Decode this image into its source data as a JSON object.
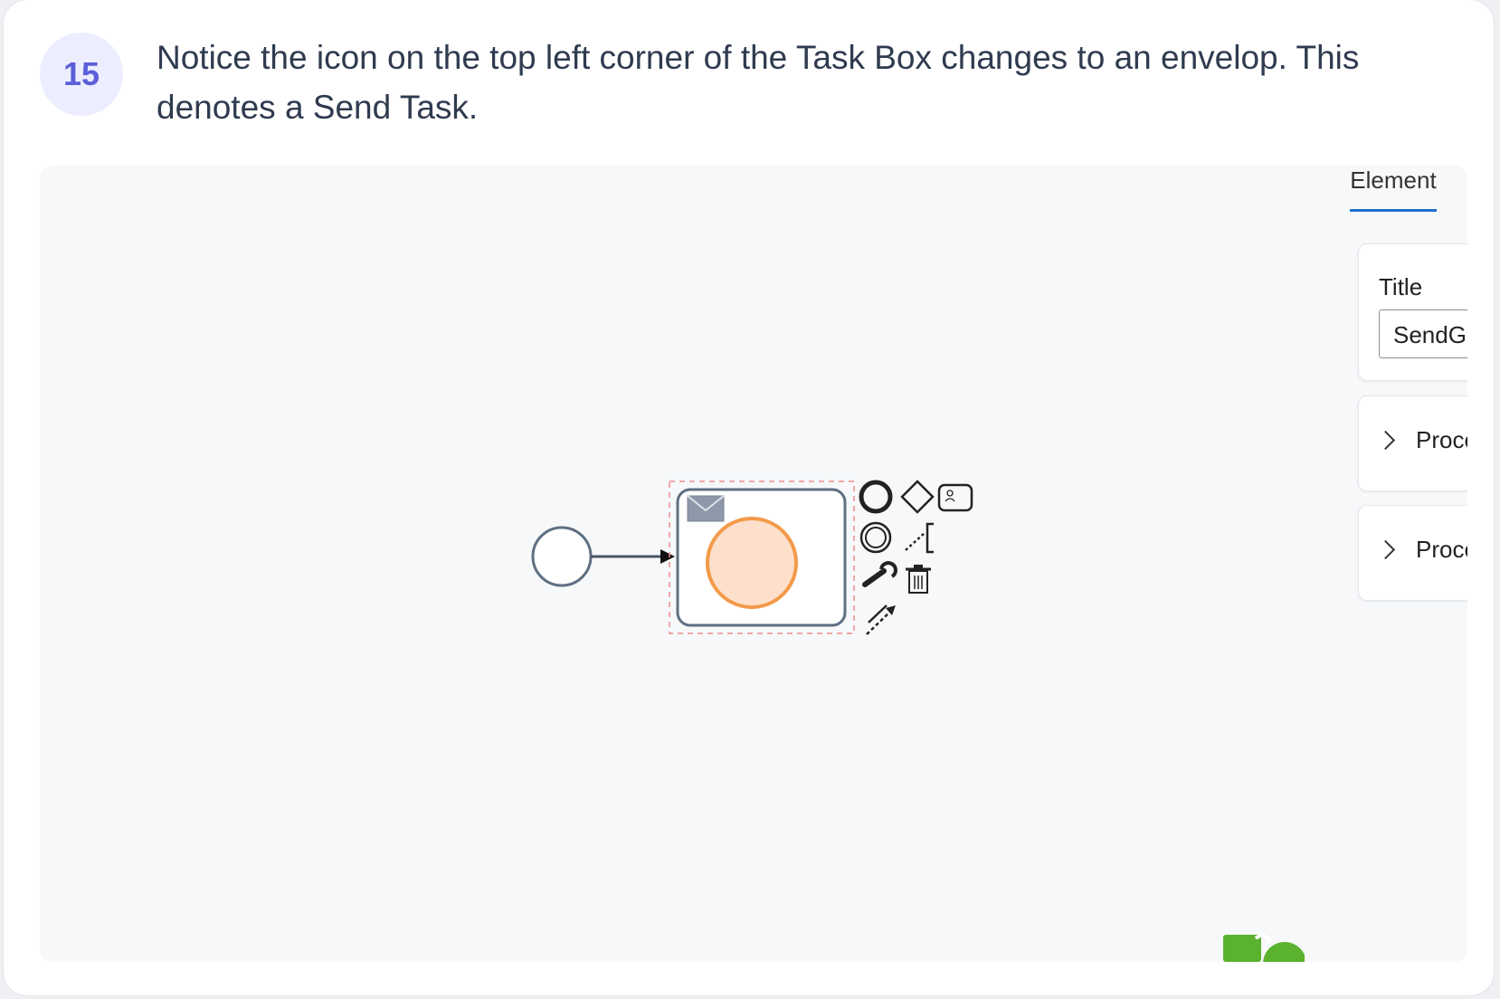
{
  "step": {
    "number": "15",
    "instruction": "Notice the icon on the top left corner of the Task Box changes to an envelop. This denotes a Send Task."
  },
  "properties_panel": {
    "tab_label": "Element",
    "title_label": "Title",
    "title_value": "SendGr",
    "sections": [
      {
        "label": "Proce"
      },
      {
        "label": "Proce"
      }
    ]
  },
  "diagram": {
    "task_marker": "envelope-icon",
    "palette": [
      "end-event-icon",
      "gateway-icon",
      "task-icon",
      "intermediate-event-icon",
      "text-annotation-icon",
      "wrench-icon",
      "delete-icon",
      "connect-icon"
    ],
    "colors": {
      "task_border": "#5f6f82",
      "task_marker": "#8d98a8",
      "token_fill": "#fde0cb",
      "token_stroke": "#f39a4a",
      "selection": "#f08a8a",
      "tab_accent": "#1f6fd1",
      "step_accent": "#5b5fd9",
      "logo_green": "#5ab22f"
    }
  }
}
